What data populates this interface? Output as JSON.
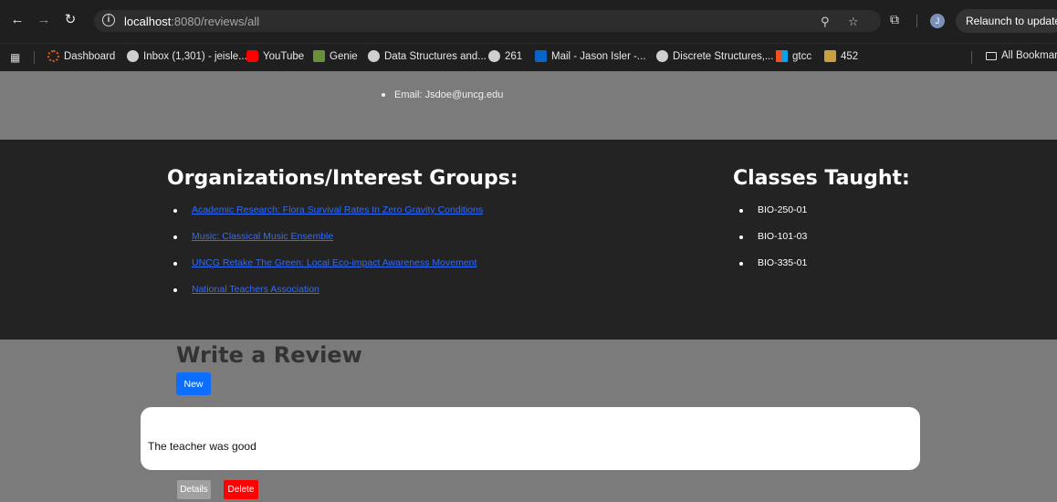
{
  "browser": {
    "url_host": "localhost",
    "url_rest": ":8080/reviews/all",
    "relaunch_label": "Relaunch to update",
    "profile_initial": "J",
    "bookmarks": [
      "Dashboard",
      "Inbox (1,301) - jeisle...",
      "YouTube",
      "Genie",
      "Data Structures and...",
      "261",
      "Mail - Jason Isler -...",
      "Discrete Structures,...",
      "gtcc",
      "452"
    ],
    "all_bookmarks_label": "All Bookmarks"
  },
  "contact": {
    "email": "Email: Jsdoe@uncg.edu"
  },
  "organizations": {
    "heading": "Organizations/Interest Groups:",
    "items": [
      "Academic Research: Flora Survival Rates In Zero Gravity Conditions",
      "Music: Classical Music Ensemble",
      "UNCG Retake The Green: Local Eco-impact Awareness Movement",
      "National Teachers Association"
    ]
  },
  "classes": {
    "heading": "Classes Taught:",
    "items": [
      "BIO-250-01",
      "BIO-101-03",
      "BIO-335-01"
    ]
  },
  "review_section": {
    "title": "Write a Review",
    "new_label": "New",
    "reviews": [
      {
        "text": "The teacher was good",
        "details_label": "Details",
        "delete_label": "Delete"
      }
    ]
  },
  "colors": {
    "page_bg": "#7b7b7b",
    "dark_band": "#232323",
    "link": "#2f6bff",
    "primary_button": "#0d6efd",
    "delete_button": "#ff0000"
  }
}
